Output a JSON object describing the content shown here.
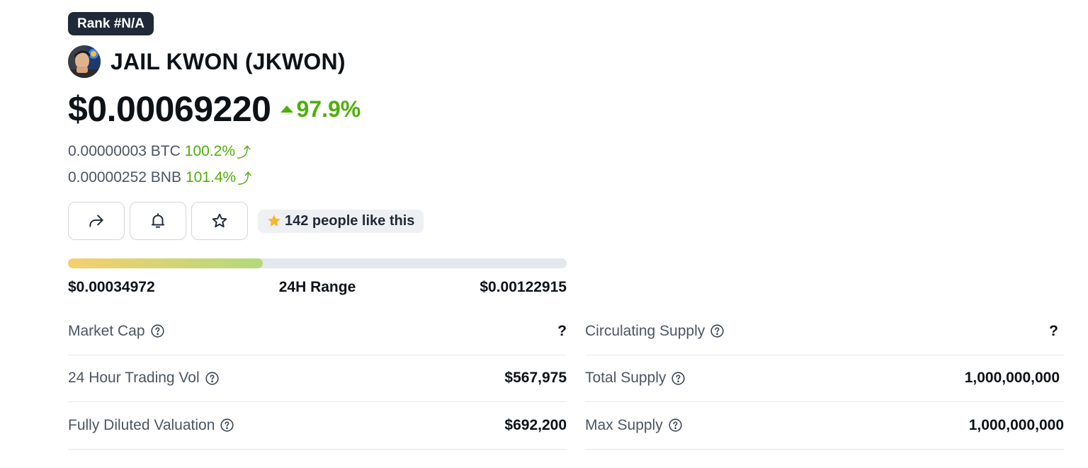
{
  "rank_badge": "Rank #N/A",
  "coin": {
    "title": "JAIL KWON (JKWON)",
    "price": "$0.00069220",
    "change_24h": "97.9%",
    "change_color": "#4eaf0a"
  },
  "conversions": [
    {
      "value": "0.00000003 BTC",
      "change": "100.2%"
    },
    {
      "value": "0.00000252 BNB",
      "change": "101.4%"
    }
  ],
  "actions": {
    "share_icon": "share-icon",
    "alert_icon": "bell-icon",
    "watchlist_icon": "star-icon",
    "likes_text": "142 people like this"
  },
  "range_24h": {
    "low": "$0.00034972",
    "label": "24H Range",
    "high": "$0.00122915",
    "position_fraction": 0.39
  },
  "stats_left": [
    {
      "label": "Market Cap",
      "value": "?"
    },
    {
      "label": "24 Hour Trading Vol",
      "value": "$567,975"
    },
    {
      "label": "Fully Diluted Valuation",
      "value": "$692,200"
    }
  ],
  "stats_right": [
    {
      "label": "Circulating Supply",
      "value": "?"
    },
    {
      "label": "Total Supply",
      "value": "1,000,000,000"
    },
    {
      "label": "Max Supply",
      "value": "1,000,000,000"
    }
  ]
}
